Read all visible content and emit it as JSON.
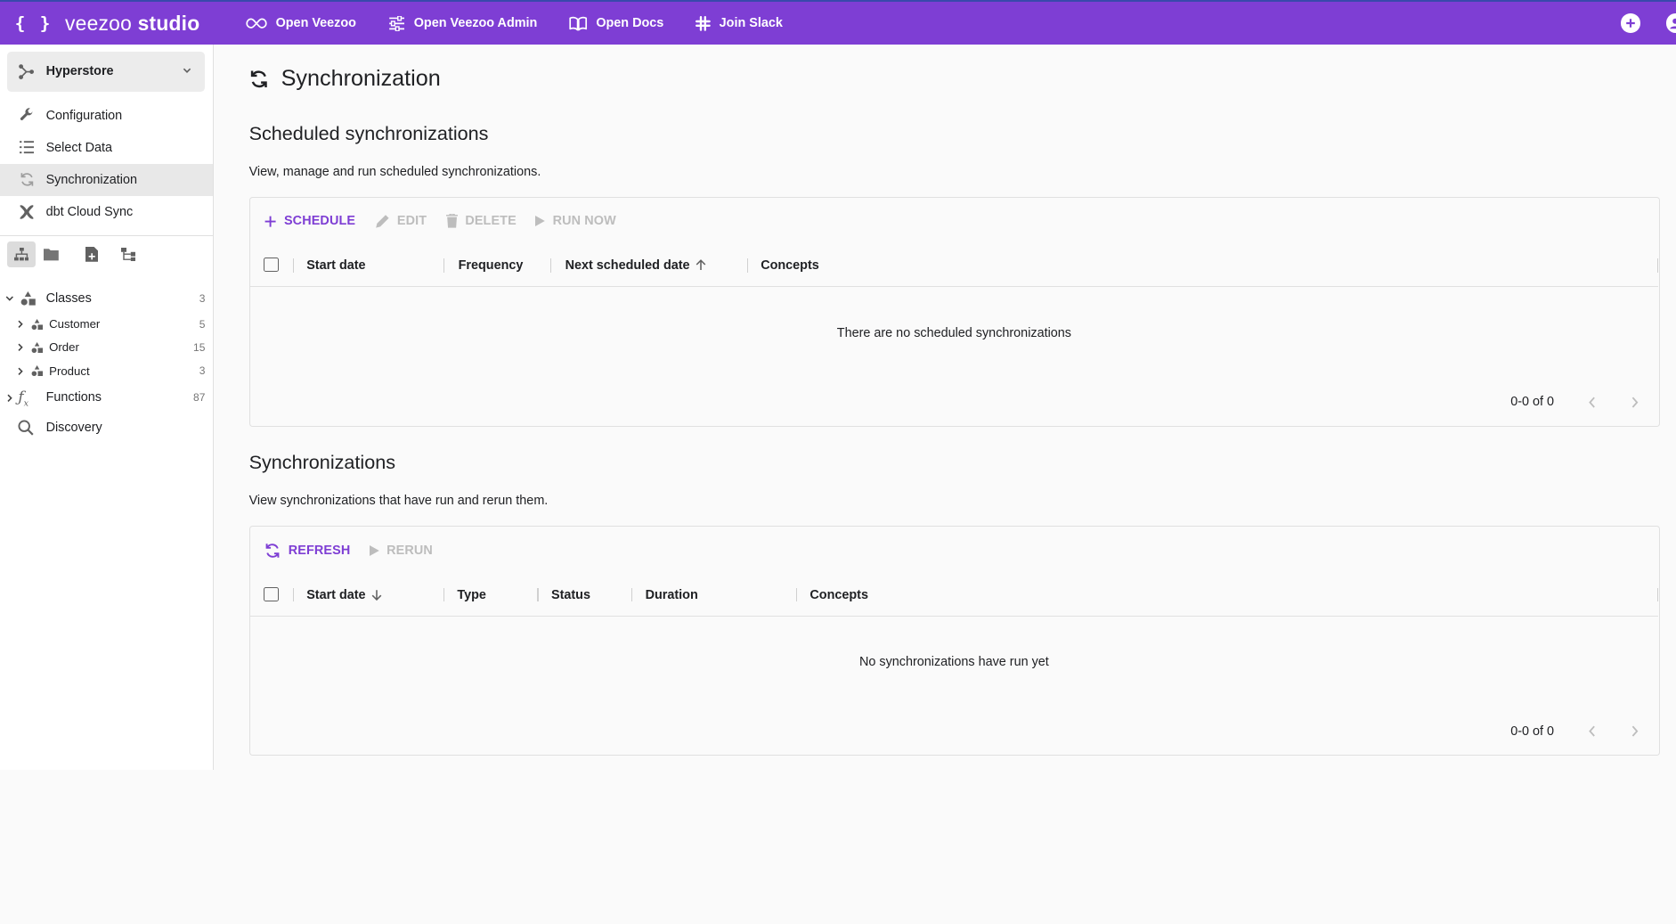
{
  "topbar": {
    "brand_braces": "{ }",
    "brand_name_light": "veezoo",
    "brand_name_bold": "studio",
    "links": [
      {
        "label": "Open Veezoo",
        "icon": "link-loop-icon"
      },
      {
        "label": "Open Veezoo Admin",
        "icon": "sliders-icon"
      },
      {
        "label": "Open Docs",
        "icon": "book-icon"
      },
      {
        "label": "Join Slack",
        "icon": "slack-icon"
      }
    ],
    "accent_color": "#7e3ed4"
  },
  "sidebar": {
    "project": "Hyperstore",
    "nav": [
      {
        "label": "Configuration",
        "icon": "wrench-icon"
      },
      {
        "label": "Select Data",
        "icon": "list-icon"
      },
      {
        "label": "Synchronization",
        "icon": "sync-icon",
        "active": true
      },
      {
        "label": "dbt Cloud Sync",
        "icon": "dbt-icon"
      }
    ],
    "tree": {
      "classes": {
        "label": "Classes",
        "count": "3"
      },
      "children": [
        {
          "label": "Customer",
          "count": "5"
        },
        {
          "label": "Order",
          "count": "15"
        },
        {
          "label": "Product",
          "count": "3"
        }
      ],
      "functions": {
        "label": "Functions",
        "count": "87"
      },
      "discovery": {
        "label": "Discovery"
      }
    }
  },
  "main": {
    "title": "Synchronization",
    "scheduled": {
      "title": "Scheduled synchronizations",
      "description": "View, manage and run scheduled synchronizations.",
      "actions": {
        "schedule": "Schedule",
        "edit": "Edit",
        "delete": "Delete",
        "run_now": "Run now"
      },
      "columns": [
        "Start date",
        "Frequency",
        "Next scheduled date",
        "Concepts"
      ],
      "empty": "There are no scheduled synchronizations",
      "pager": "0-0 of 0"
    },
    "history": {
      "title": "Synchronizations",
      "description": "View synchronizations that have run and rerun them.",
      "actions": {
        "refresh": "Refresh",
        "rerun": "Rerun"
      },
      "columns": [
        "Start date",
        "Type",
        "Status",
        "Duration",
        "Concepts"
      ],
      "empty": "No synchronizations have run yet",
      "pager": "0-0 of 0"
    }
  }
}
